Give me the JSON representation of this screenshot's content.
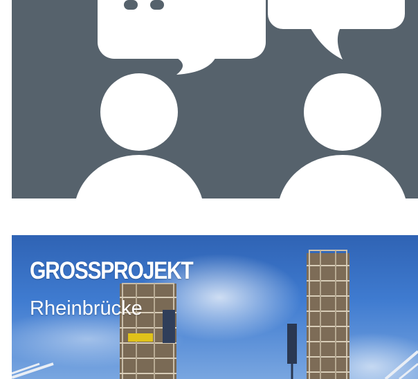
{
  "tiles": [
    {
      "icon": "community-chat-icon",
      "background": "#56626c"
    },
    {
      "title": "GROSSPROJEKT",
      "subtitle": "Rheinbrücke",
      "image": "bridge-pylons-photo"
    }
  ],
  "colors": {
    "icon_background": "#56626c",
    "icon_foreground": "#ffffff",
    "sky": "#3f7bd0",
    "title_text": "#ffffff"
  }
}
